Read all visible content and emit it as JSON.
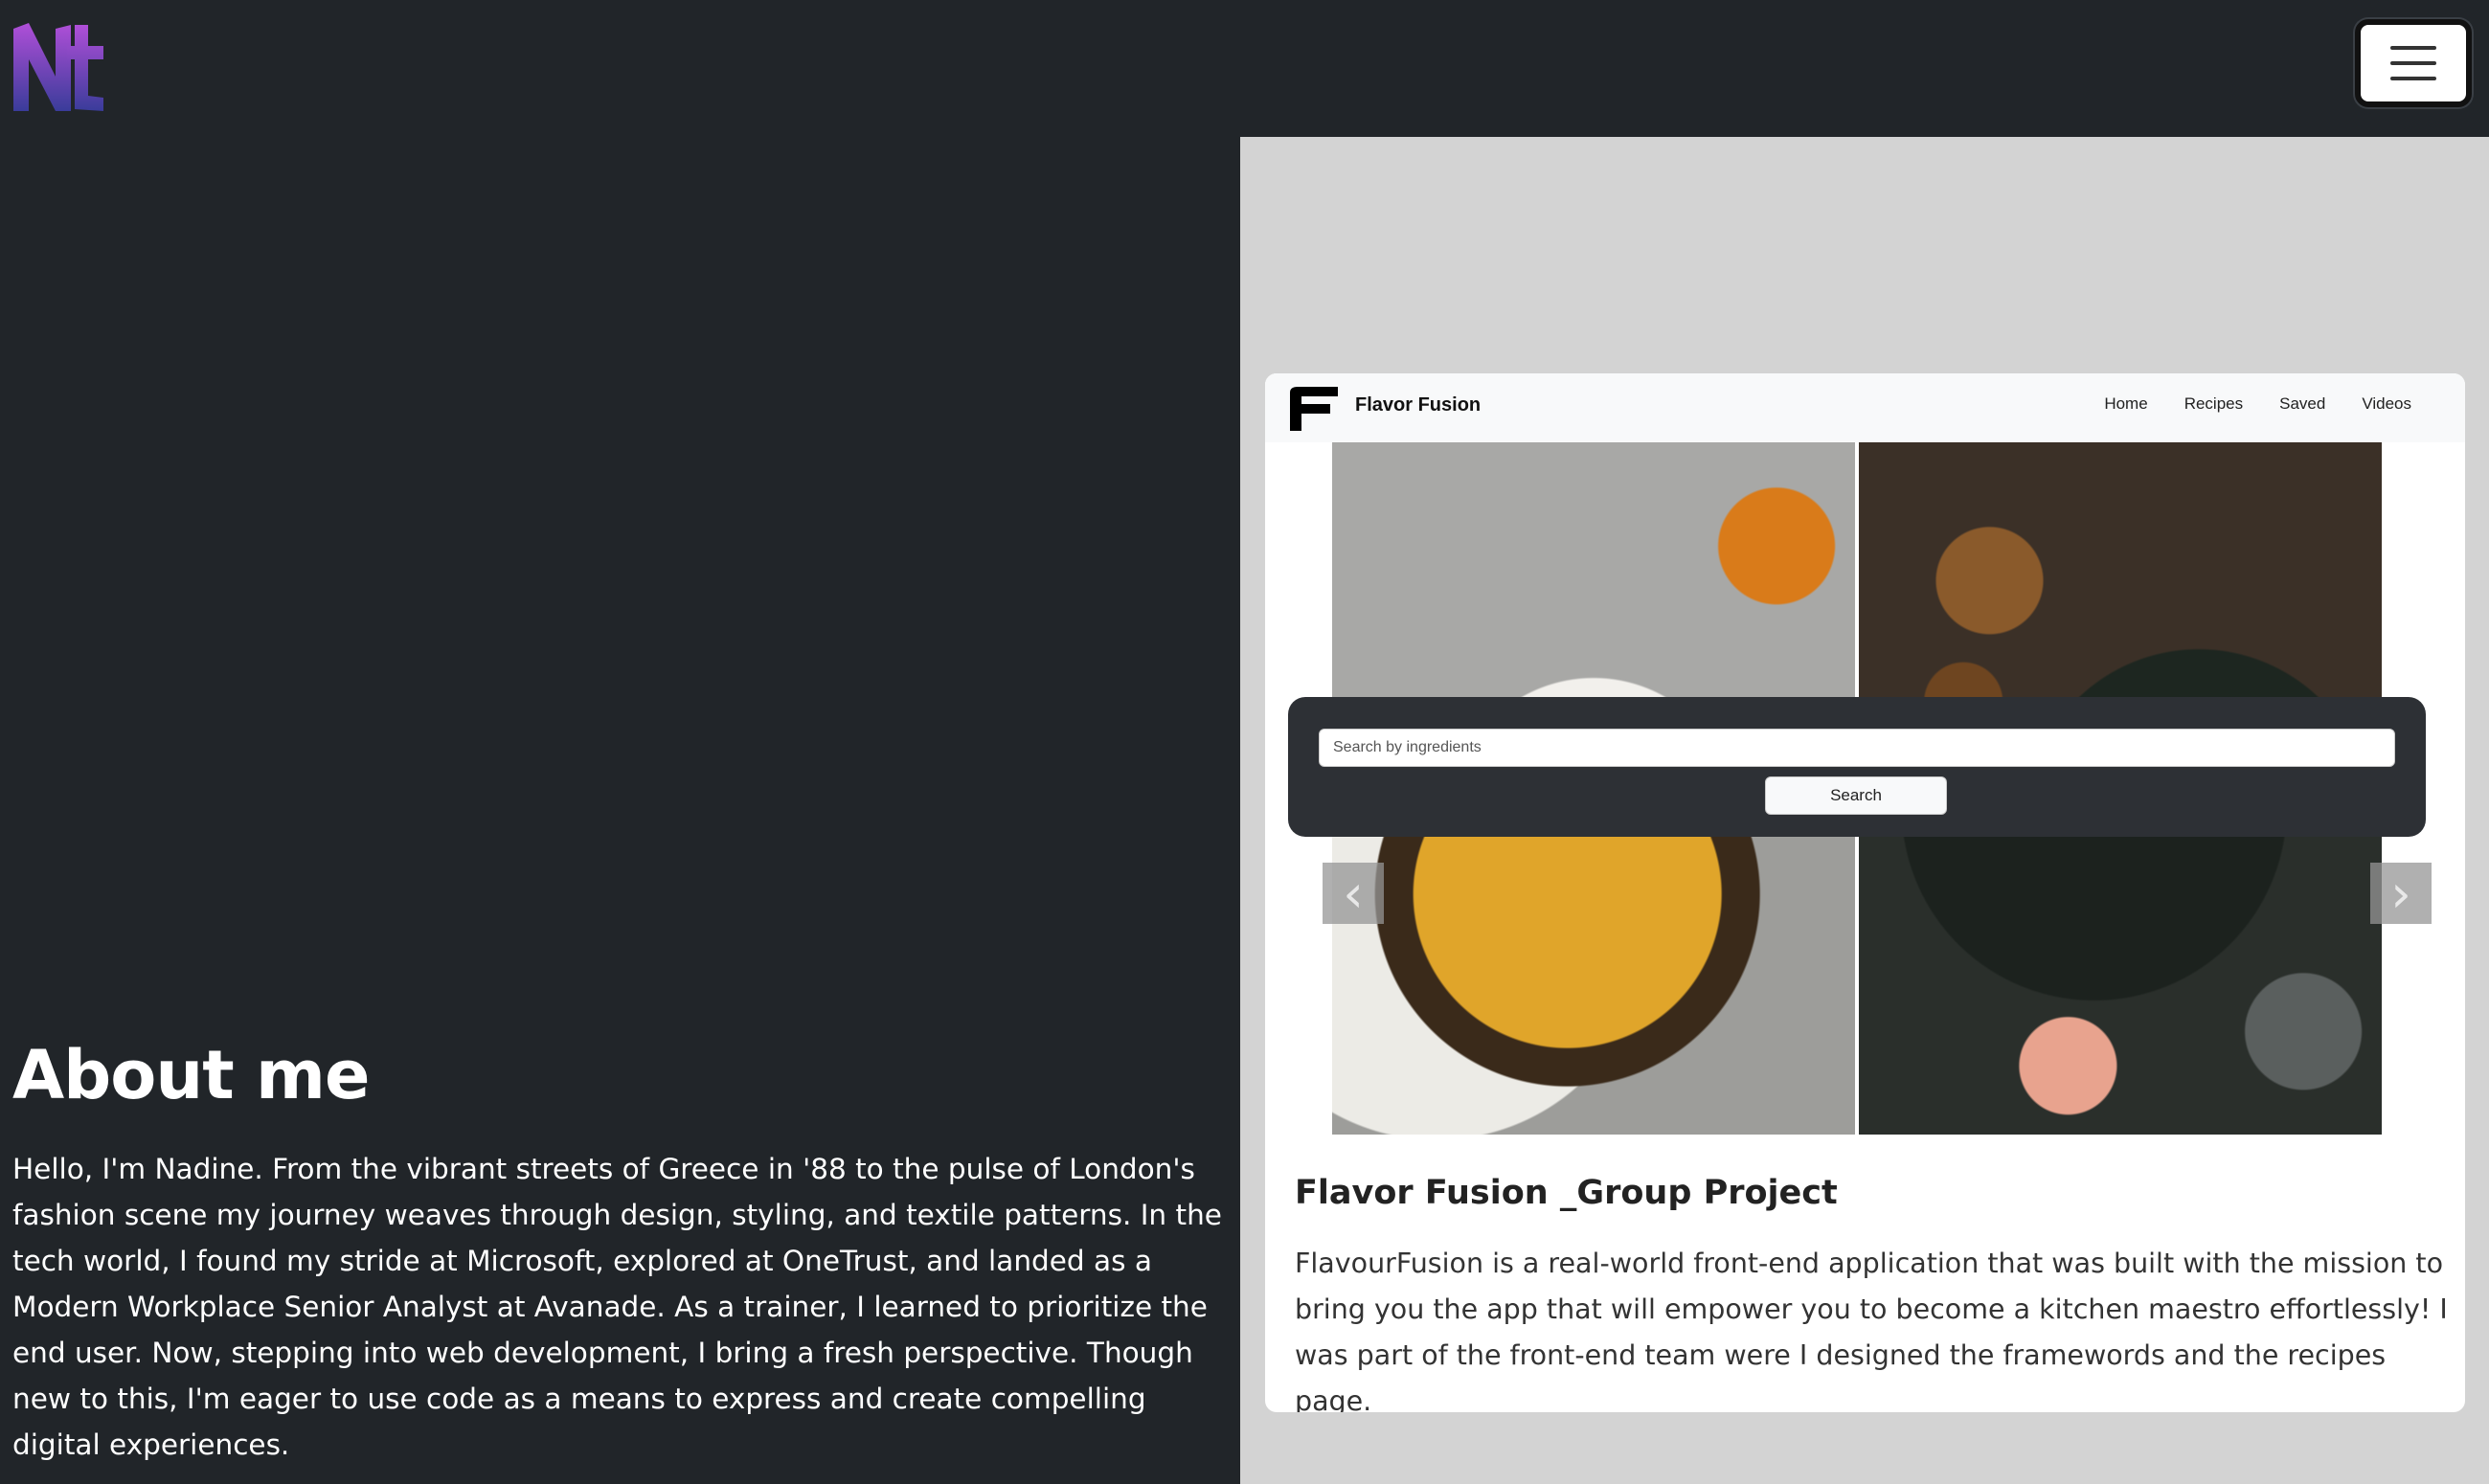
{
  "header": {
    "logo_text": "Nt",
    "menu_icon": "hamburger-icon"
  },
  "about": {
    "title": "About me",
    "text": "Hello, I'm Nadine. From the vibrant streets of Greece in '88 to the pulse of London's fashion scene my journey weaves through design, styling, and textile patterns. In the tech world, I found my stride at Microsoft, explored at OneTrust, and landed as a Modern Workplace Senior Analyst at Avanade. As a trainer, I learned to prioritize the end user. Now, stepping into web development, I bring a fresh perspective. Though new to this, I'm eager to use code as a means to express and create compelling digital experiences."
  },
  "project": {
    "screenshot": {
      "brand": "Flavor Fusion",
      "nav": [
        "Home",
        "Recipes",
        "Saved",
        "Videos"
      ],
      "search_placeholder": "Search by ingredients",
      "search_button": "Search"
    },
    "title": "Flavor Fusion _Group Project",
    "description": "FlavourFusion is a real-world front-end application that was built with the mission to bring you the app that will empower you to become a kitchen maestro effortlessly! I was part of the front-end team were I designed the framewords and the recipes page."
  },
  "colors": {
    "page_bg": "#212529",
    "panel_bg": "#d3d3d3",
    "logo_gradient_top": "#a64dd6",
    "logo_gradient_bottom": "#3a3f9e"
  }
}
